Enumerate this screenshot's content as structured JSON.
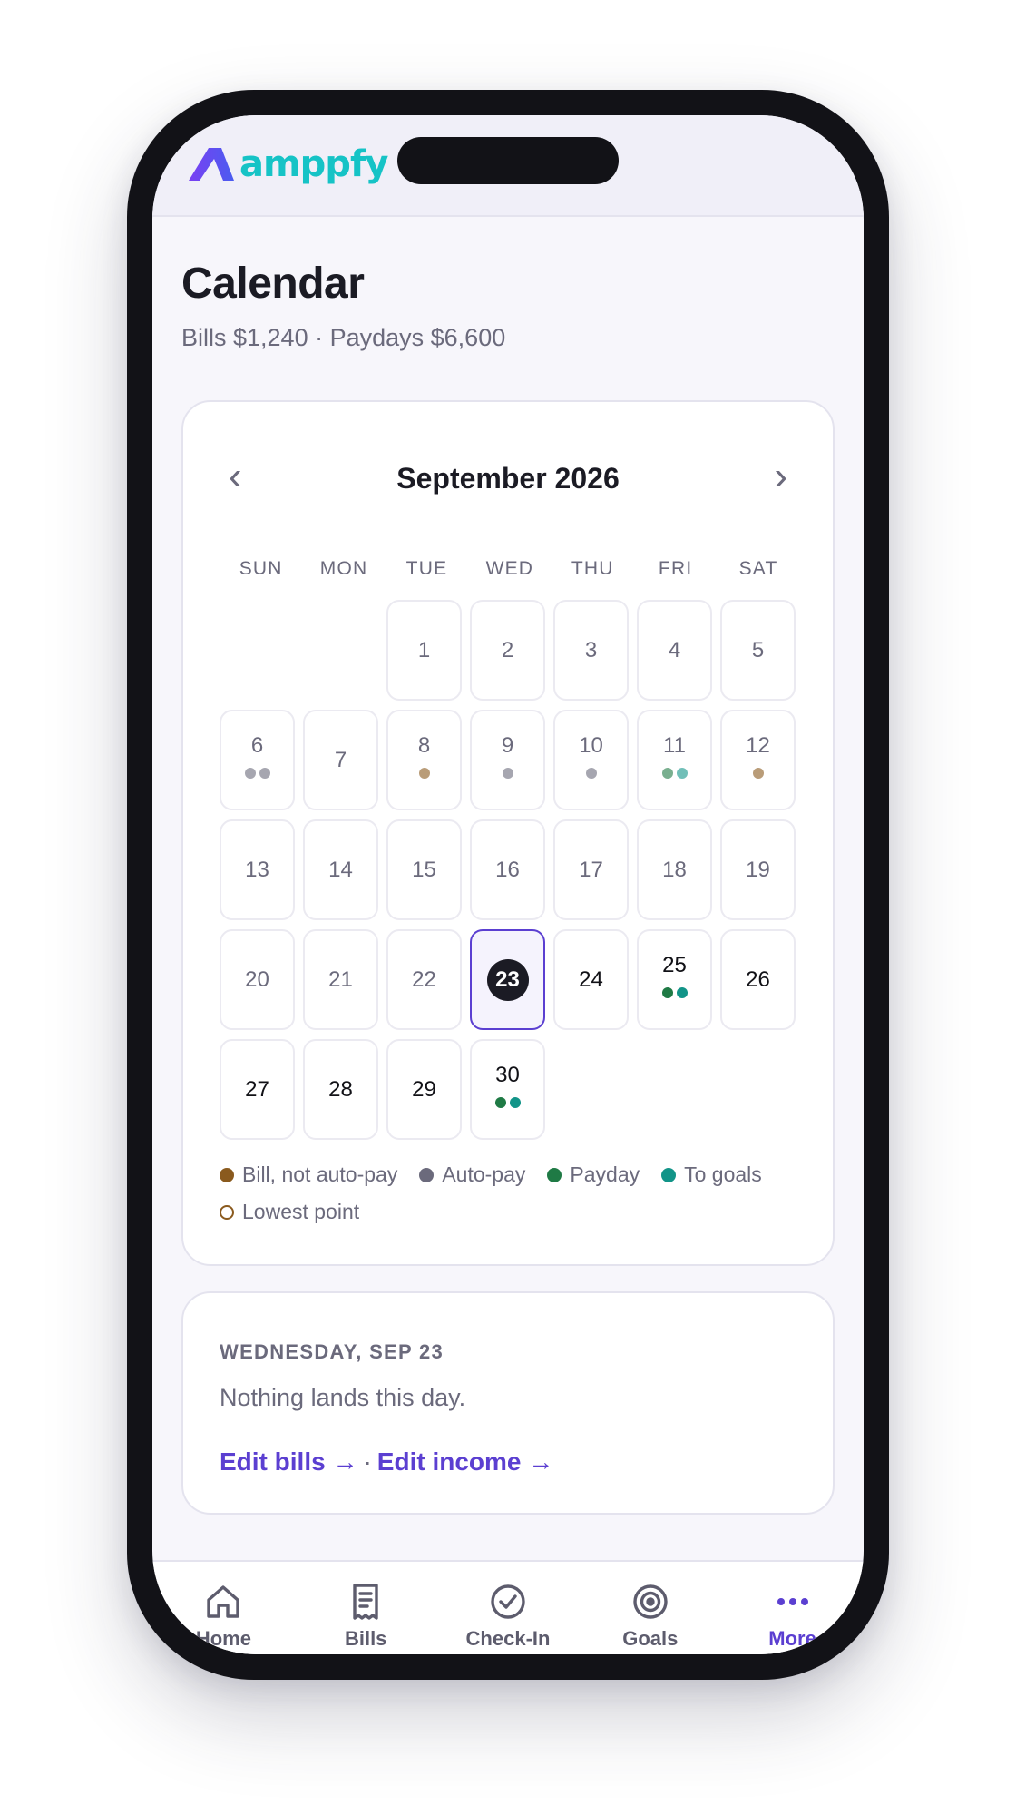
{
  "brand": {
    "name": "amppfy",
    "color": "#16c3c6",
    "accent": "#6a3ff0"
  },
  "header": {
    "title": "Calendar",
    "summary": "Bills $1,240 · Paydays $6,600"
  },
  "calendar": {
    "month_label": "September 2026",
    "prev_label": "‹",
    "next_label": "›",
    "weekdays": [
      "SUN",
      "MON",
      "TUE",
      "WED",
      "THU",
      "FRI",
      "SAT"
    ],
    "leading_blanks": 2,
    "today": 23,
    "days": [
      {
        "n": 1,
        "dots": []
      },
      {
        "n": 2,
        "dots": []
      },
      {
        "n": 3,
        "dots": []
      },
      {
        "n": 4,
        "dots": []
      },
      {
        "n": 5,
        "dots": []
      },
      {
        "n": 6,
        "dots": [
          "autopay",
          "autopay"
        ]
      },
      {
        "n": 7,
        "dots": []
      },
      {
        "n": 8,
        "dots": [
          "bill"
        ]
      },
      {
        "n": 9,
        "dots": [
          "autopay"
        ]
      },
      {
        "n": 10,
        "dots": [
          "autopay"
        ]
      },
      {
        "n": 11,
        "dots": [
          "payday",
          "goals"
        ]
      },
      {
        "n": 12,
        "dots": [
          "bill"
        ]
      },
      {
        "n": 13,
        "dots": []
      },
      {
        "n": 14,
        "dots": []
      },
      {
        "n": 15,
        "dots": []
      },
      {
        "n": 16,
        "dots": []
      },
      {
        "n": 17,
        "dots": []
      },
      {
        "n": 18,
        "dots": []
      },
      {
        "n": 19,
        "dots": []
      },
      {
        "n": 20,
        "dots": []
      },
      {
        "n": 21,
        "dots": []
      },
      {
        "n": 22,
        "dots": []
      },
      {
        "n": 23,
        "dots": []
      },
      {
        "n": 24,
        "dots": []
      },
      {
        "n": 25,
        "dots": [
          "payday",
          "goals"
        ]
      },
      {
        "n": 26,
        "dots": []
      },
      {
        "n": 27,
        "dots": []
      },
      {
        "n": 28,
        "dots": []
      },
      {
        "n": 29,
        "dots": []
      },
      {
        "n": 30,
        "dots": [
          "payday",
          "goals"
        ]
      }
    ],
    "colors": {
      "bill": "#8a5a1e",
      "autopay": "#6b6a7c",
      "payday": "#1f7a45",
      "goals": "#129488"
    },
    "legend": [
      {
        "key": "bill",
        "label": "Bill, not auto-pay"
      },
      {
        "key": "autopay",
        "label": "Auto-pay"
      },
      {
        "key": "payday",
        "label": "Payday"
      },
      {
        "key": "goals",
        "label": "To goals"
      },
      {
        "key": "lowest",
        "label": "Lowest point"
      }
    ]
  },
  "selected_day": {
    "label": "WEDNESDAY, SEP 23",
    "message": "Nothing lands this day.",
    "edit_bills": "Edit bills →",
    "separator": "·",
    "edit_income": "Edit income →"
  },
  "tabs": [
    {
      "key": "home",
      "label": "Home",
      "icon": "house-icon"
    },
    {
      "key": "bills",
      "label": "Bills",
      "icon": "receipt-icon"
    },
    {
      "key": "checkin",
      "label": "Check-In",
      "icon": "check-circle-icon"
    },
    {
      "key": "goals",
      "label": "Goals",
      "icon": "target-icon"
    },
    {
      "key": "more",
      "label": "More",
      "icon": "more-dots-icon",
      "active": true
    }
  ]
}
